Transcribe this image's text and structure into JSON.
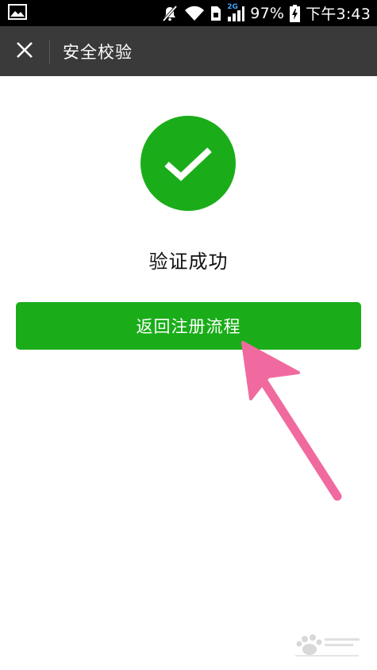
{
  "status_bar": {
    "network_label": "2G",
    "battery_percent": "97%",
    "time": "下午3:43",
    "icons": [
      "gallery-icon",
      "mute-icon",
      "wifi-icon",
      "sim-icon",
      "signal-icon",
      "battery-charging-icon"
    ]
  },
  "title_bar": {
    "close_icon": "close-icon",
    "title": "安全校验"
  },
  "main": {
    "success_icon": "check-circle-icon",
    "result_text": "验证成功",
    "return_button_label": "返回注册流程"
  },
  "colors": {
    "accent_green": "#1aad19",
    "title_bar_bg": "#3a3a3a",
    "annotation_arrow": "#f06aa0"
  },
  "watermark": {
    "icon": "baidu-paw-watermark"
  }
}
